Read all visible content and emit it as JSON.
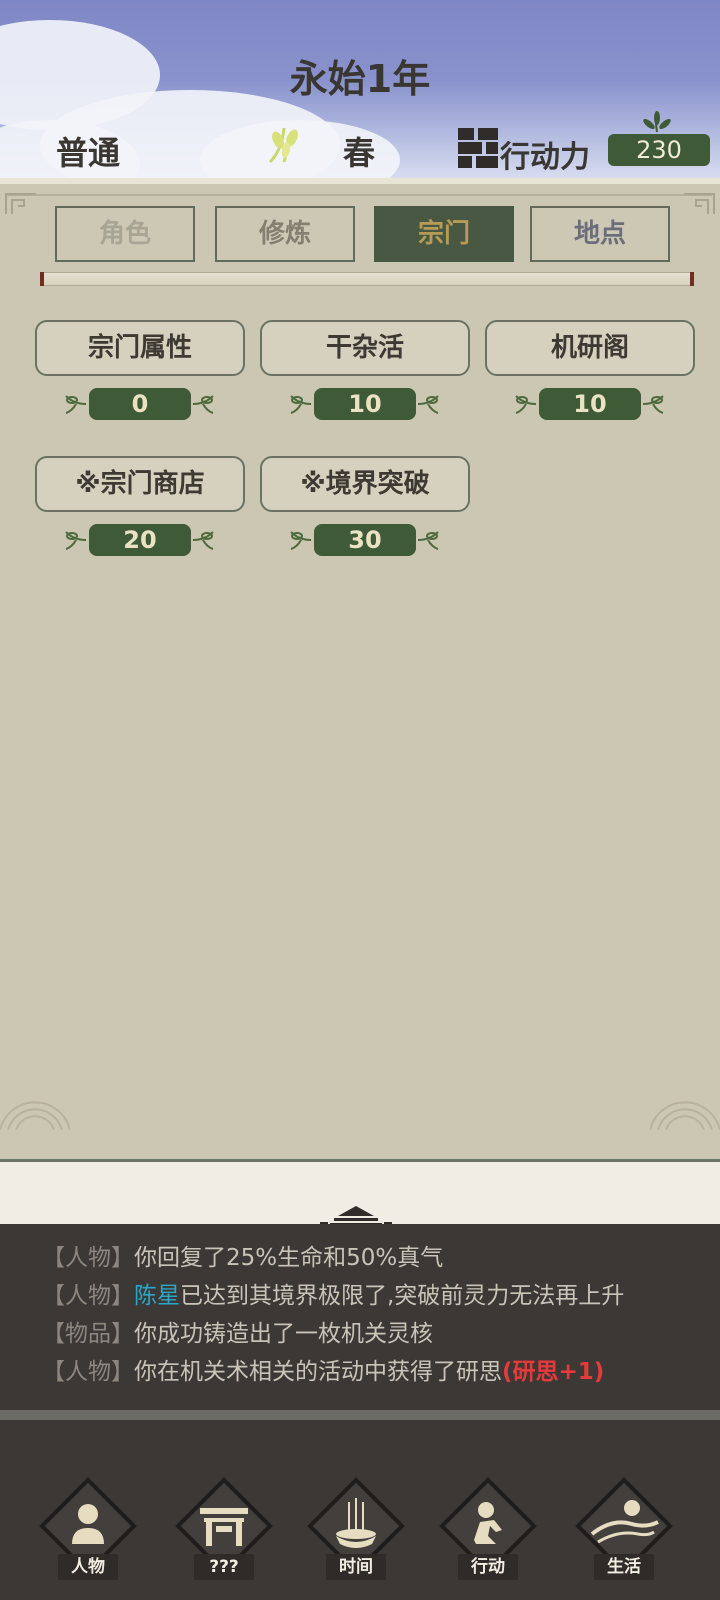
{
  "header": {
    "title": "永始1年",
    "mode": "普通",
    "season": "春",
    "season_icon": "wheat-icon",
    "action_points_label": "行动力",
    "action_points_icon": "wall-icon",
    "action_points_value": "230"
  },
  "tabs": [
    {
      "label": "角色",
      "state": "inactive"
    },
    {
      "label": "修炼",
      "state": "inactive"
    },
    {
      "label": "宗门",
      "state": "active"
    },
    {
      "label": "地点",
      "state": "inactive"
    }
  ],
  "activities": [
    {
      "label": "宗门属性",
      "cost": "0"
    },
    {
      "label": "干杂活",
      "cost": "10"
    },
    {
      "label": "机研阁",
      "cost": "10"
    },
    {
      "label": "※宗门商店",
      "cost": "20"
    },
    {
      "label": "※境界突破",
      "cost": "30"
    }
  ],
  "log": [
    {
      "category": "【人物】",
      "text": "你回复了25%生命和50%真气"
    },
    {
      "category": "【人物】",
      "name": "陈星",
      "text": "已达到其境界极限了,突破前灵力无法再上升"
    },
    {
      "category": "【物品】",
      "text": "你成功铸造出了一枚机关灵核"
    },
    {
      "category": "【人物】",
      "text": "你在机关术相关的活动中获得了研思",
      "gain": "(研思+1)"
    }
  ],
  "nav": [
    {
      "label": "人物",
      "icon": "person-icon"
    },
    {
      "label": "???",
      "icon": "gate-icon"
    },
    {
      "label": "时间",
      "icon": "incense-icon"
    },
    {
      "label": "行动",
      "icon": "action-icon"
    },
    {
      "label": "生活",
      "icon": "landscape-icon"
    }
  ],
  "colors": {
    "accent_green": "#3f5a36",
    "active_tab_text": "#b79c58",
    "name_highlight": "#2aa7c9",
    "gain_highlight": "#e53a3a"
  }
}
